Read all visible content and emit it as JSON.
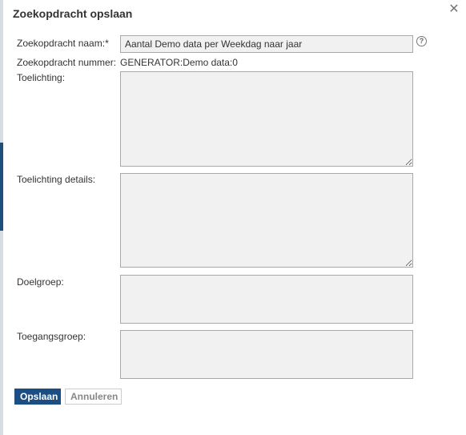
{
  "dialog": {
    "title": "Zoekopdracht opslaan",
    "close_icon": "close-icon",
    "help_icon": "help-icon",
    "help_glyph": "?"
  },
  "form": {
    "name_label": "Zoekopdracht naam:*",
    "name_value": "Aantal Demo data per Weekdag naar jaar",
    "number_label": "Zoekopdracht nummer:",
    "number_value": "GENERATOR:Demo data:0",
    "explanation_label": "Toelichting:",
    "explanation_value": "",
    "explanation_details_label": "Toelichting details:",
    "explanation_details_value": "",
    "target_group_label": "Doelgroep:",
    "access_group_label": "Toegangsgroep:"
  },
  "buttons": {
    "save_label": "Opslaan",
    "cancel_label": "Annuleren"
  },
  "colors": {
    "primary": "#1b4e82",
    "field_bg": "#f1f1f1"
  }
}
